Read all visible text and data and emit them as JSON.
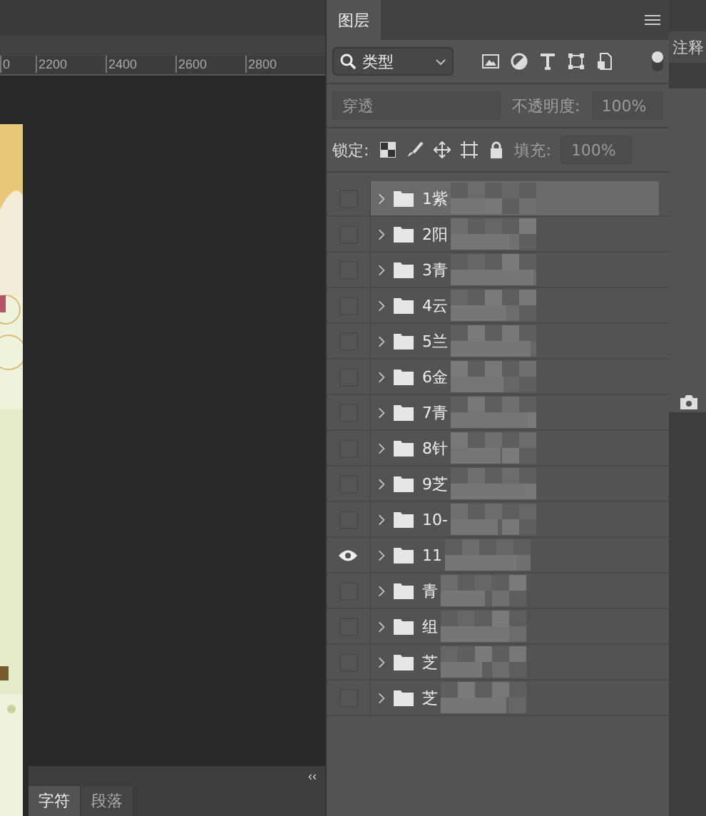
{
  "ruler": {
    "ticks": [
      "0",
      "2200",
      "2400",
      "2600",
      "2800"
    ]
  },
  "char_panel": {
    "collapse": "‹‹",
    "tabs": [
      {
        "label": "字符",
        "selected": true
      },
      {
        "label": "段落",
        "selected": false
      }
    ]
  },
  "layers_panel": {
    "tab": "图层",
    "filter": {
      "value": "类型",
      "on": true
    },
    "blend": {
      "value": "穿透",
      "disabled": true
    },
    "opacity": {
      "label": "不透明度:",
      "value": "100%",
      "disabled": true
    },
    "lock": {
      "label": "锁定:"
    },
    "fill": {
      "label": "填充:",
      "value": "100%",
      "disabled": true
    },
    "layers": [
      {
        "name": "1紫",
        "visible": false,
        "selected": true
      },
      {
        "name": "2阳",
        "visible": false,
        "selected": false
      },
      {
        "name": "3青",
        "visible": false,
        "selected": false
      },
      {
        "name": "4云",
        "visible": false,
        "selected": false
      },
      {
        "name": "5兰",
        "visible": false,
        "selected": false
      },
      {
        "name": "6金",
        "visible": false,
        "selected": false
      },
      {
        "name": "7青",
        "visible": false,
        "selected": false
      },
      {
        "name": "8针",
        "visible": false,
        "selected": false
      },
      {
        "name": "9芝",
        "visible": false,
        "selected": false
      },
      {
        "name": "10-",
        "visible": false,
        "selected": false
      },
      {
        "name": "11",
        "visible": true,
        "selected": false
      },
      {
        "name": "青",
        "visible": false,
        "selected": false
      },
      {
        "name": "组",
        "visible": false,
        "selected": false
      },
      {
        "name": "芝",
        "visible": false,
        "selected": false
      },
      {
        "name": "芝",
        "visible": false,
        "selected": false
      }
    ]
  },
  "right_strip": {
    "tab": "注释"
  }
}
